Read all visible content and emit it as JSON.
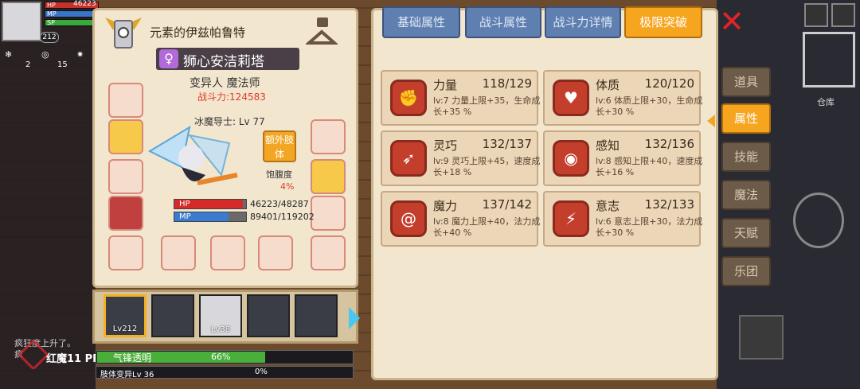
{
  "hud": {
    "hp_label": "HP",
    "mp_label": "MP",
    "sp_label": "SP",
    "hp_value": "46223",
    "level": "212",
    "buffs": [
      {
        "icon": "snowflake-icon",
        "count": "2"
      },
      {
        "icon": "swirl-icon",
        "count": "15"
      },
      {
        "icon": "gear-icon",
        "count": ""
      }
    ]
  },
  "character": {
    "title": "元素的伊兹帕鲁特",
    "name": "狮心安洁莉塔",
    "gender_icon": "♀",
    "class": "变异人 魔法师",
    "power": "战斗力:124583",
    "sub_class": "冰魔导士: Lv 77",
    "extra_limb": "额外肢体",
    "satiety_label": "饱腹度",
    "satiety_value": "4%",
    "hp_label": "HP",
    "mp_label": "MP",
    "hp_value": "46223/48287",
    "mp_value": "89401/119202",
    "hp_fraction": 0.957,
    "mp_fraction": 0.75
  },
  "party": [
    {
      "level": "Lv212",
      "selected": true
    },
    {
      "level": "",
      "selected": false
    },
    {
      "level": "Lv38",
      "selected": false
    },
    {
      "level": "",
      "selected": false
    },
    {
      "level": "",
      "selected": false
    }
  ],
  "progress": {
    "name": "气锋透明",
    "percent": "66%",
    "fraction": 0.66,
    "name2": "肢体变异Lv 36",
    "percent2": "0%"
  },
  "chat": {
    "line1": "疯狂度上升了。",
    "line2": "疯"
  },
  "watermark": "红魔11 PRO+",
  "tabs": [
    {
      "label": "基础属性",
      "active": false
    },
    {
      "label": "战斗属性",
      "active": false
    },
    {
      "label": "战斗力详情",
      "active": false
    },
    {
      "label": "极限突破",
      "active": true
    }
  ],
  "attributes": [
    {
      "name": "力量",
      "value": "118/129",
      "desc": "lv:7 力量上限+35，生命成长+35 %",
      "icon": "muscle-arm-icon"
    },
    {
      "name": "体质",
      "value": "120/120",
      "desc": "lv:6 体质上限+30，生命成长+30 %",
      "icon": "body-icon"
    },
    {
      "name": "灵巧",
      "value": "132/137",
      "desc": "lv:9 灵巧上限+45，速度成长+18 %",
      "icon": "running-icon"
    },
    {
      "name": "感知",
      "value": "132/136",
      "desc": "lv:8 感知上限+40，速度成长+16 %",
      "icon": "eye-icon"
    },
    {
      "name": "魔力",
      "value": "137/142",
      "desc": "lv:8 魔力上限+40，法力成长+40 %",
      "icon": "spiral-icon"
    },
    {
      "name": "意志",
      "value": "132/133",
      "desc": "lv:6 意志上限+30，法力成长+30 %",
      "icon": "mind-icon"
    }
  ],
  "side_tabs": [
    {
      "label": "道具",
      "active": false
    },
    {
      "label": "属性",
      "active": true
    },
    {
      "label": "技能",
      "active": false
    },
    {
      "label": "魔法",
      "active": false
    },
    {
      "label": "天赋",
      "active": false
    },
    {
      "label": "乐团",
      "active": false
    }
  ],
  "warehouse": "仓库",
  "colors": {
    "panel_bg": "#f2e6cf",
    "tab_blue": "#5f7fb0",
    "tab_active": "#f6a51f",
    "power_red": "#e23a2a",
    "icon_red": "#c33f2c"
  }
}
